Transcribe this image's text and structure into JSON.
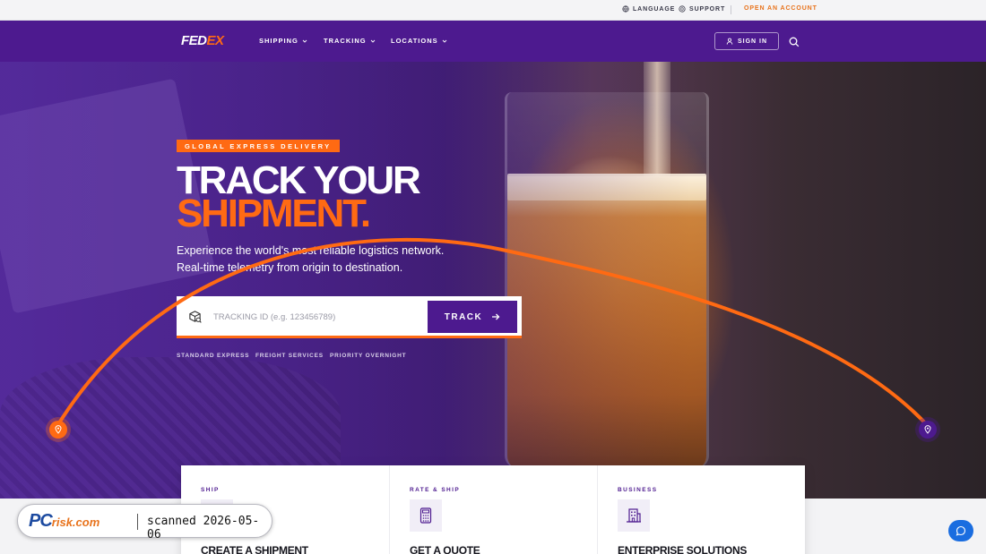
{
  "utility_bar": {
    "language": "LANGUAGE",
    "support": "SUPPORT",
    "open_account": "OPEN AN ACCOUNT"
  },
  "nav": {
    "logo_left": "FED",
    "logo_right": "EX",
    "items": [
      {
        "label": "SHIPPING"
      },
      {
        "label": "TRACKING"
      },
      {
        "label": "LOCATIONS"
      }
    ],
    "sign_in": "SIGN IN"
  },
  "hero": {
    "tag": "GLOBAL EXPRESS DELIVERY",
    "headline_line1": "TRACK YOUR",
    "headline_line2": "SHIPMENT.",
    "subtext_line1": "Experience the world's most reliable logistics network.",
    "subtext_line2": "Real-time telemetry from origin to destination.",
    "tracking_placeholder": "TRACKING ID (e.g. 123456789)",
    "track_button": "TRACK",
    "quick_links": [
      {
        "label": "STANDARD EXPRESS"
      },
      {
        "label": "FREIGHT SERVICES"
      },
      {
        "label": "PRIORITY OVERNIGHT"
      }
    ]
  },
  "cards": [
    {
      "eyebrow": "SHIP",
      "title": "CREATE A SHIPMENT",
      "icon": "package-icon"
    },
    {
      "eyebrow": "RATE & SHIP",
      "title": "GET A QUOTE",
      "icon": "calculator-icon"
    },
    {
      "eyebrow": "BUSINESS",
      "title": "ENTERPRISE SOLUTIONS",
      "icon": "building-icon"
    }
  ],
  "watermark": {
    "brand": "PC",
    "brand_suffix": "risk.com",
    "scanned": "scanned 2026-05-06"
  },
  "colors": {
    "brand_purple": "#4d1a8f",
    "brand_orange": "#ff6a13",
    "chat_blue": "#1a6de0"
  }
}
